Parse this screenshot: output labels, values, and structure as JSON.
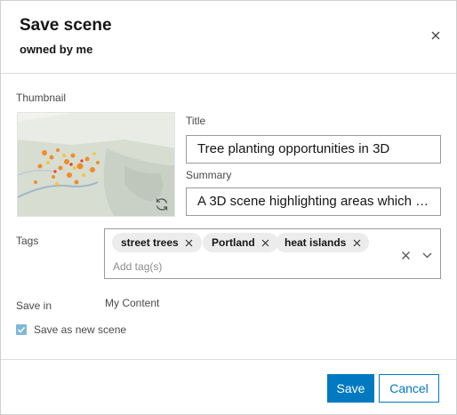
{
  "dialog": {
    "title": "Save scene",
    "subtitle": "owned by me",
    "close_icon": "close-icon"
  },
  "thumbnail": {
    "label": "Thumbnail",
    "refresh_icon": "refresh-icon"
  },
  "title_field": {
    "label": "Title",
    "value": "Tree planting opportunities in 3D"
  },
  "summary_field": {
    "label": "Summary",
    "value": "A 3D scene highlighting areas which w..."
  },
  "tags": {
    "label": "Tags",
    "items": [
      {
        "label": "street trees"
      },
      {
        "label": "Portland"
      },
      {
        "label": "heat islands"
      }
    ],
    "placeholder": "Add tag(s)",
    "clear_icon": "close-icon",
    "toggle_icon": "chevron-down-icon"
  },
  "save_in": {
    "label": "Save in",
    "value": "My Content"
  },
  "save_as_new": {
    "label": "Save as new scene",
    "checked": true
  },
  "footer": {
    "save_label": "Save",
    "cancel_label": "Cancel"
  },
  "colors": {
    "accent": "#0079c1",
    "checkbox": "#7fb8d8",
    "chip_bg": "#ececec",
    "border": "#9a9a9a"
  }
}
